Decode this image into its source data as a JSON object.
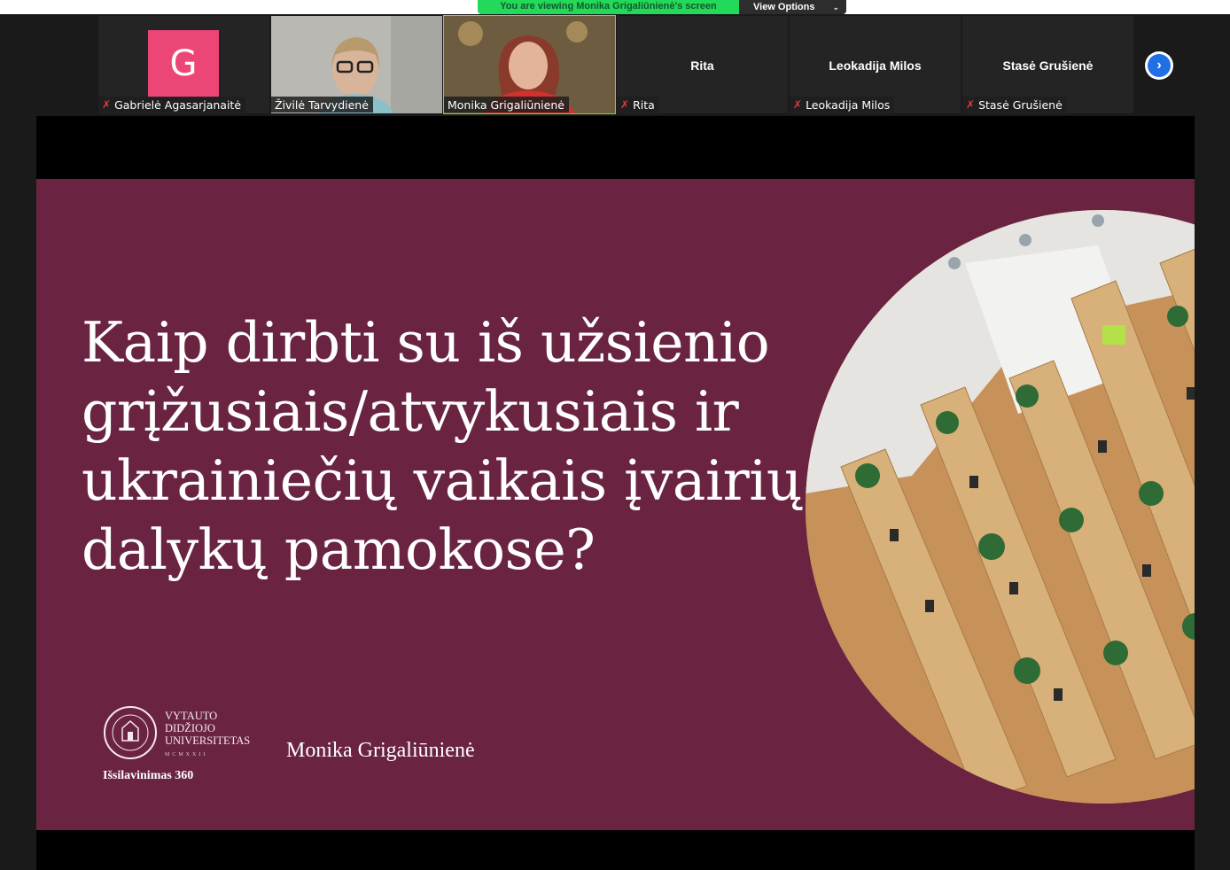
{
  "banner": {
    "message": "You are viewing Monika Grigaliūnienė's screen",
    "view_options": "View Options"
  },
  "participants": [
    {
      "name": "Gabrielė Agasarjanaitė",
      "avatar_letter": "G",
      "avatar_color": "#ec4677",
      "muted": true,
      "video": false
    },
    {
      "name": "Živilė Tarvydienė",
      "muted": false,
      "video": true
    },
    {
      "name": "Monika Grigaliūnienė",
      "muted": false,
      "video": true,
      "active_speaker": true
    },
    {
      "name": "Rita",
      "display_name": "Rita",
      "muted": true,
      "video": false
    },
    {
      "name": "Leokadija Milos",
      "display_name": "Leokadija Milos",
      "muted": true,
      "video": false
    },
    {
      "name": "Stasė Grušienė",
      "display_name": "Stasė Grušienė",
      "muted": true,
      "video": false
    }
  ],
  "slide": {
    "title_lines": [
      "Kaip dirbti su iš užsienio",
      "grįžusiais/atvykusiais ir",
      "ukrainiečių vaikais įvairių",
      "dalykų pamokose?"
    ],
    "university_lines": [
      "VYTAUTO",
      "DIDŽIOJO",
      "UNIVERSITETAS"
    ],
    "university_year": "MCMXXII",
    "education_label": "Išsilavinimas 360",
    "presenter": "Monika Grigaliūnienė",
    "background_color": "#6a2442"
  },
  "colors": {
    "banner_green": "#23d959",
    "active_border": "#8fcf3a",
    "next_button": "#1f6fe5"
  }
}
